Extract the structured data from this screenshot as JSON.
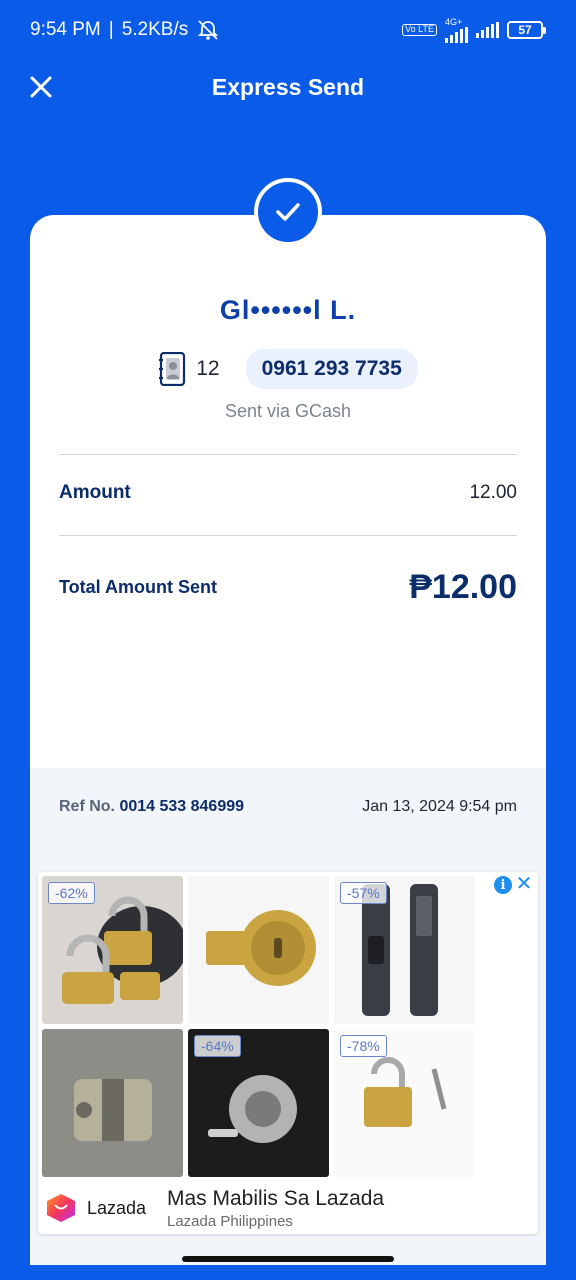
{
  "status_bar": {
    "time": "9:54 PM",
    "net_speed": "5.2KB/s",
    "volte_label": "Vo LTE",
    "network_type": "4G+",
    "battery": "57"
  },
  "header": {
    "title": "Express Send"
  },
  "recipient": {
    "name": "Gl••••••l L.",
    "contact_count": "12",
    "phone": "0961 293 7735",
    "sent_via": "Sent via GCash"
  },
  "amount": {
    "label": "Amount",
    "value": "12.00"
  },
  "total": {
    "label": "Total Amount Sent",
    "value": "₱12.00"
  },
  "reference": {
    "label": "Ref No.",
    "number": "0014 533 846999",
    "date": "Jan 13, 2024 9:54 pm"
  },
  "ad": {
    "discounts": [
      "-62%",
      "",
      "-57%",
      "",
      "-64%",
      "-78%"
    ],
    "brand": "Lazada",
    "headline": "Mas Mabilis Sa Lazada",
    "subtitle": "Lazada Philippines",
    "info_icon": "info-icon",
    "close_icon": "close-icon"
  },
  "colors": {
    "brand_blue": "#0a5be8",
    "dark_navy": "#0c2d6b",
    "footer_bg": "#f2f5fa"
  }
}
